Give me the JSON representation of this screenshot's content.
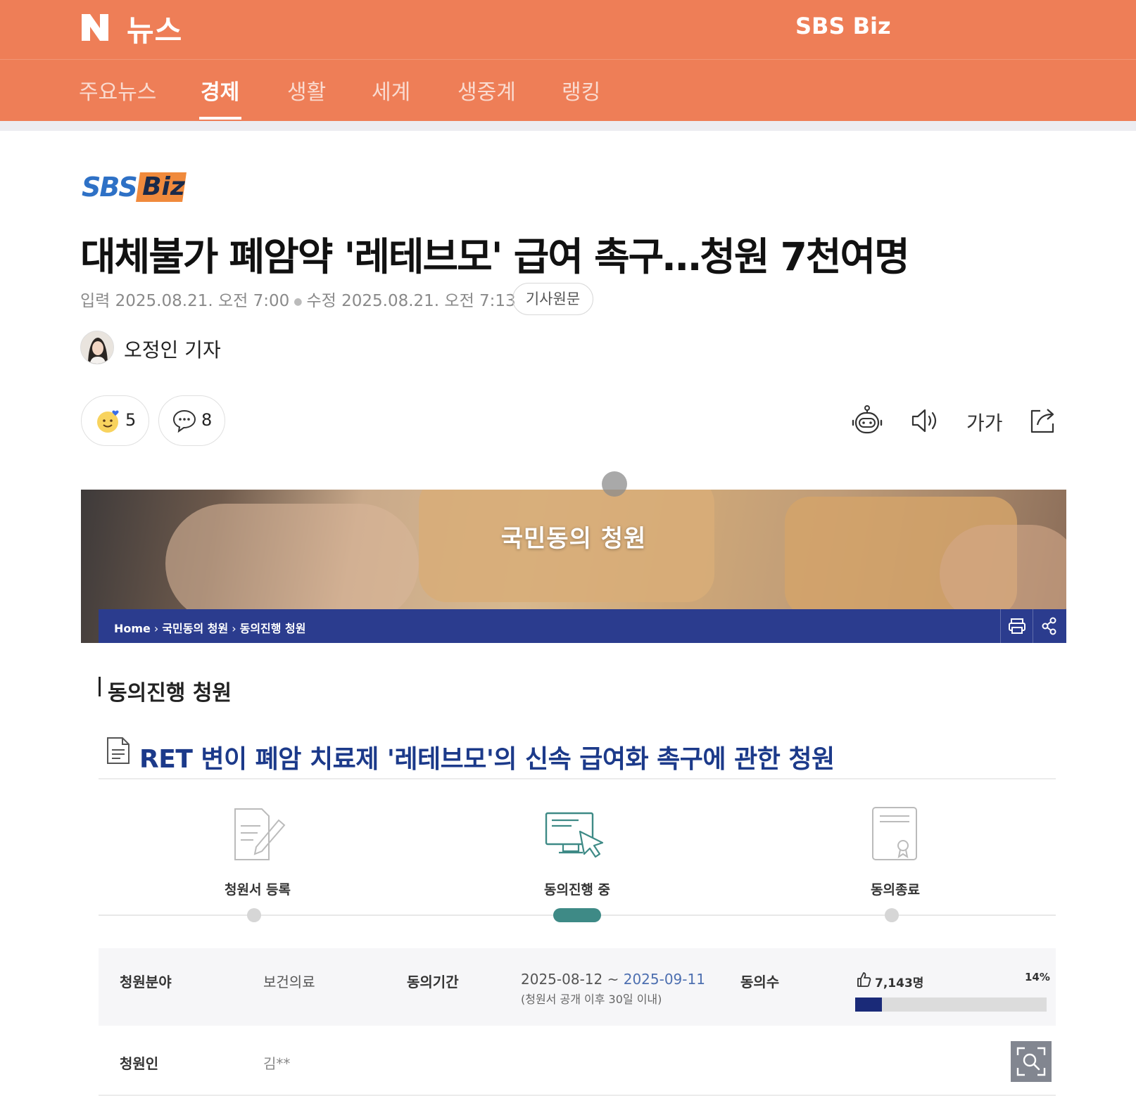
{
  "header": {
    "logo_text": "뉴스",
    "brand": "SBS Biz",
    "tabs": [
      {
        "label": "주요뉴스",
        "active": false
      },
      {
        "label": "경제",
        "active": true
      },
      {
        "label": "생활",
        "active": false
      },
      {
        "label": "세계",
        "active": false
      },
      {
        "label": "생중계",
        "active": false
      },
      {
        "label": "랭킹",
        "active": false
      }
    ],
    "colors": {
      "accent": "#ee7e57"
    }
  },
  "article": {
    "source_logo": {
      "sbs": "SBS",
      "biz": "Biz"
    },
    "headline": "대체불가 폐암약 '레테브모' 급여 촉구…청원 7천여명",
    "input_label": "입력",
    "input_time": "2025.08.21. 오전 7:00",
    "modified_label": "수정",
    "modified_time": "2025.08.21. 오전 7:13",
    "original_button": "기사원문",
    "reporter": "오정인 기자",
    "reactions": {
      "emoji_icon": "smile-heart-icon",
      "emoji_count": "5",
      "comment_icon": "comment-icon",
      "comment_count": "8"
    },
    "tools": [
      "summary-bot-icon",
      "tts-speaker-icon",
      "font-size-icon",
      "share-icon"
    ],
    "font_size_label": "가가"
  },
  "embedded": {
    "banner_title": "국민동의 청원",
    "breadcrumbs": [
      "Home",
      "국민동의 청원",
      "동의진행 청원"
    ],
    "section_title": "동의진행 청원",
    "petition_title": "RET 변이 폐암 치료제 '레테브모'의 신속 급여화 촉구에 관한 청원",
    "stages": [
      {
        "label": "청원서 등록",
        "icon": "pen-document-icon",
        "active": false
      },
      {
        "label": "동의진행 중",
        "icon": "monitor-click-icon",
        "active": true
      },
      {
        "label": "동의종료",
        "icon": "certificate-icon",
        "active": false
      }
    ],
    "info": {
      "field_label": "청원분야",
      "field_value": "보건의료",
      "period_label": "동의기간",
      "period_start": "2025-08-12",
      "period_sep": " ~ ",
      "period_end": "2025-09-11",
      "period_note": "(청원서 공개 이후 30일 이내)",
      "count_label": "동의수",
      "count_value": "7,143명",
      "percent_label": "14%",
      "percent": 0.14,
      "petitioner_label": "청원인",
      "petitioner_value": "김**"
    }
  }
}
